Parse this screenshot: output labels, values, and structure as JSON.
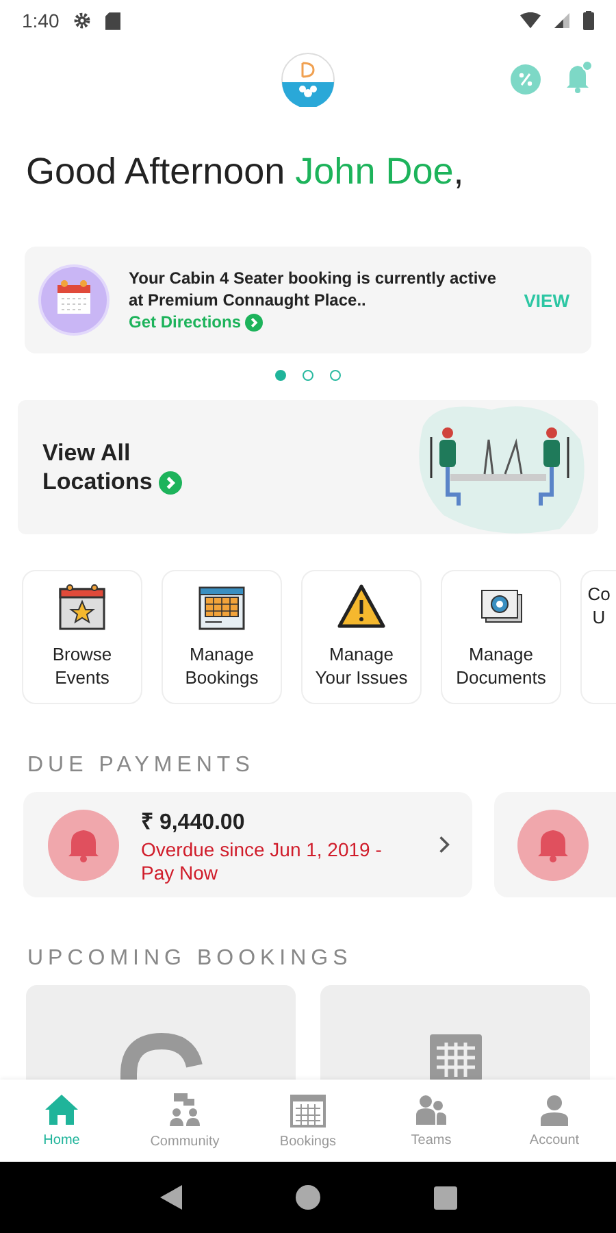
{
  "status_bar": {
    "time": "1:40"
  },
  "greeting": {
    "text": "Good Afternoon",
    "name": "John Doe",
    "suffix": ","
  },
  "banner": {
    "message": "Your Cabin 4 Seater booking is currently active at Premium Connaught Place..",
    "link": "Get Directions",
    "action": "VIEW"
  },
  "carousel_dots": [
    {
      "selected": true
    },
    {
      "selected": false
    },
    {
      "selected": false
    }
  ],
  "locations_card": {
    "title": "View All Locations"
  },
  "quick_actions": [
    {
      "kind": "events",
      "lines": [
        "Browse",
        "Events"
      ]
    },
    {
      "kind": "bookings",
      "lines": [
        "Manage",
        "Bookings"
      ]
    },
    {
      "kind": "issues",
      "lines": [
        "Manage",
        "Your Issues"
      ]
    },
    {
      "kind": "documents",
      "lines": [
        "Manage",
        "Documents"
      ]
    },
    {
      "kind": "partial",
      "lines": [
        "Co",
        "U"
      ]
    }
  ],
  "due_payments": {
    "title": "DUE PAYMENTS",
    "items": [
      {
        "amount": "₹ 9,440.00",
        "status": "Overdue since Jun 1, 2019 - Pay Now"
      }
    ]
  },
  "upcoming_bookings": {
    "title": "UPCOMING BOOKINGS"
  },
  "bottom_nav": [
    {
      "kind": "home",
      "label": "Home",
      "selected": true
    },
    {
      "kind": "community",
      "label": "Community",
      "selected": false
    },
    {
      "kind": "bookings",
      "label": "Bookings",
      "selected": false
    },
    {
      "kind": "teams",
      "label": "Teams",
      "selected": false
    },
    {
      "kind": "account",
      "label": "Account",
      "selected": false
    }
  ]
}
